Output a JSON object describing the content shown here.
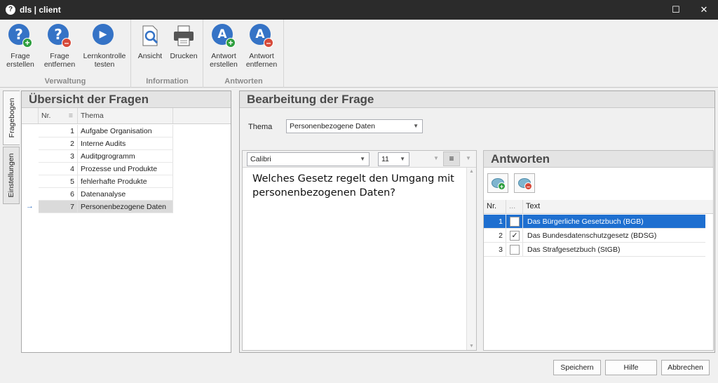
{
  "window": {
    "app_icon": "dls-logo-icon",
    "title": "dls | client",
    "maximize_glyph": "☐",
    "close_glyph": "✕"
  },
  "ribbon": {
    "groups": [
      {
        "label": "Verwaltung",
        "buttons": [
          {
            "label1": "Frage",
            "label2": "erstellen",
            "icon": "question-add-icon"
          },
          {
            "label1": "Frage",
            "label2": "entfernen",
            "icon": "question-remove-icon"
          },
          {
            "label1": "Lernkontrolle",
            "label2": "testen",
            "icon": "play-icon"
          }
        ]
      },
      {
        "label": "Information",
        "buttons": [
          {
            "label1": "Ansicht",
            "icon": "preview-icon"
          },
          {
            "label1": "Drucken",
            "icon": "printer-icon"
          }
        ]
      },
      {
        "label": "Antworten",
        "buttons": [
          {
            "label1": "Antwort",
            "label2": "erstellen",
            "icon": "answer-add-icon"
          },
          {
            "label1": "Antwort",
            "label2": "entfernen",
            "icon": "answer-remove-icon"
          }
        ]
      }
    ]
  },
  "side_tabs": [
    "Fragebogen",
    "Einstellungen"
  ],
  "overview": {
    "title": "Übersicht der Fragen",
    "columns": [
      "Nr.",
      "Thema"
    ],
    "rows": [
      {
        "nr": "1",
        "thema": "Aufgabe Organisation"
      },
      {
        "nr": "2",
        "thema": "Interne Audits"
      },
      {
        "nr": "3",
        "thema": "Auditpgrogramm"
      },
      {
        "nr": "4",
        "thema": "Prozesse und Produkte"
      },
      {
        "nr": "5",
        "thema": "fehlerhafte Produkte"
      },
      {
        "nr": "6",
        "thema": "Datenanalyse"
      },
      {
        "nr": "7",
        "thema": "Personenbezogene Daten"
      }
    ],
    "selected_row": 7
  },
  "editor": {
    "title": "Bearbeitung der Frage",
    "thema_label": "Thema",
    "thema_value": "Personenbezogene Daten",
    "font_name": "Calibri",
    "font_size": "11",
    "question_text": "Welches Gesetz regelt den Umgang mit personenbezogenen Daten?"
  },
  "answers": {
    "title": "Antworten",
    "columns": [
      "Nr.",
      "...",
      "Text"
    ],
    "rows": [
      {
        "nr": "1",
        "checked": false,
        "text": "Das Bürgerliche Gesetzbuch (BGB)"
      },
      {
        "nr": "2",
        "checked": true,
        "text": "Das Bundesdatenschutzgesetz (BDSG)"
      },
      {
        "nr": "3",
        "checked": false,
        "text": "Das Strafgesetzbuch (StGB)"
      }
    ],
    "selected_row": 1,
    "check_glyph": "✓"
  },
  "footer": {
    "save": "Speichern",
    "help": "Hilfe",
    "cancel": "Abbrechen"
  },
  "colors": {
    "accent": "#3573c6",
    "selection": "#1e6fd0",
    "titlebar": "#2b2b2b"
  }
}
